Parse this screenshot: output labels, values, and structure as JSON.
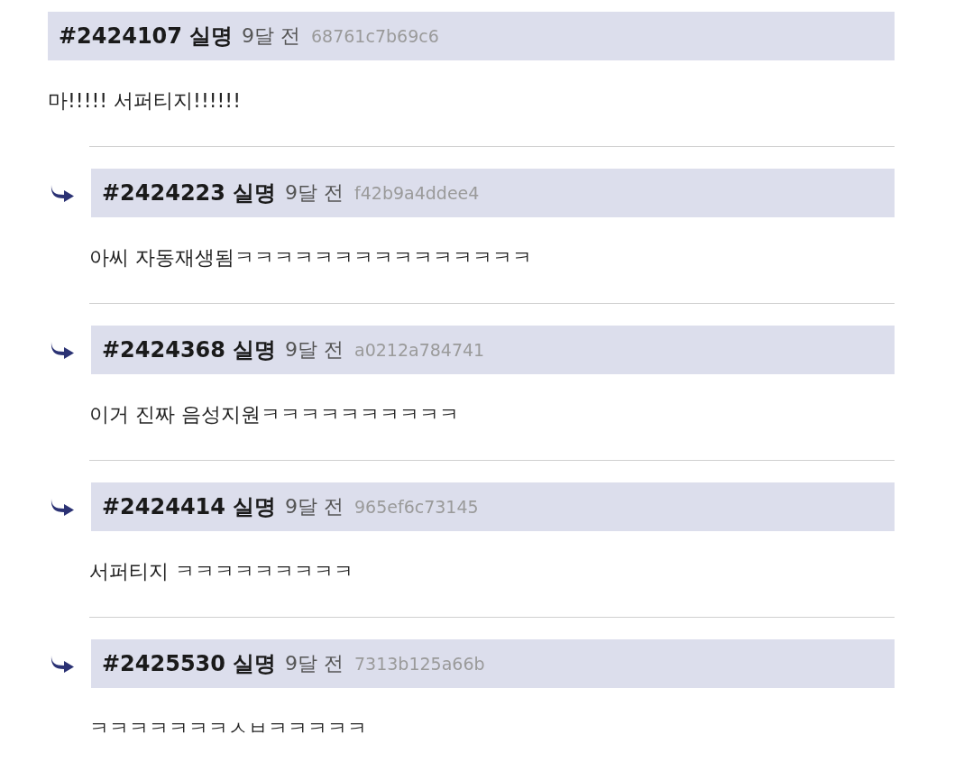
{
  "comments": [
    {
      "kind": "root",
      "number": "#2424107",
      "author": "실명",
      "time": "9달 전",
      "hash": "68761c7b69c6",
      "body": "마!!!!! 서퍼티지!!!!!!"
    },
    {
      "kind": "reply",
      "number": "#2424223",
      "author": "실명",
      "time": "9달 전",
      "hash": "f42b9a4ddee4",
      "body": "아씨 자동재생됨ㅋㅋㅋㅋㅋㅋㅋㅋㅋㅋㅋㅋㅋㅋㅋ"
    },
    {
      "kind": "reply",
      "number": "#2424368",
      "author": "실명",
      "time": "9달 전",
      "hash": "a0212a784741",
      "body": "이거 진짜 음성지원ㅋㅋㅋㅋㅋㅋㅋㅋㅋㅋ"
    },
    {
      "kind": "reply",
      "number": "#2424414",
      "author": "실명",
      "time": "9달 전",
      "hash": "965ef6c73145",
      "body": "서퍼티지 ㅋㅋㅋㅋㅋㅋㅋㅋㅋ"
    },
    {
      "kind": "reply",
      "number": "#2425530",
      "author": "실명",
      "time": "9달 전",
      "hash": "7313b125a66b",
      "body": "ㅋㅋㅋㅋㅋㅋㅋㅅㅂㅋㅋㅋㅋㅋ"
    }
  ]
}
